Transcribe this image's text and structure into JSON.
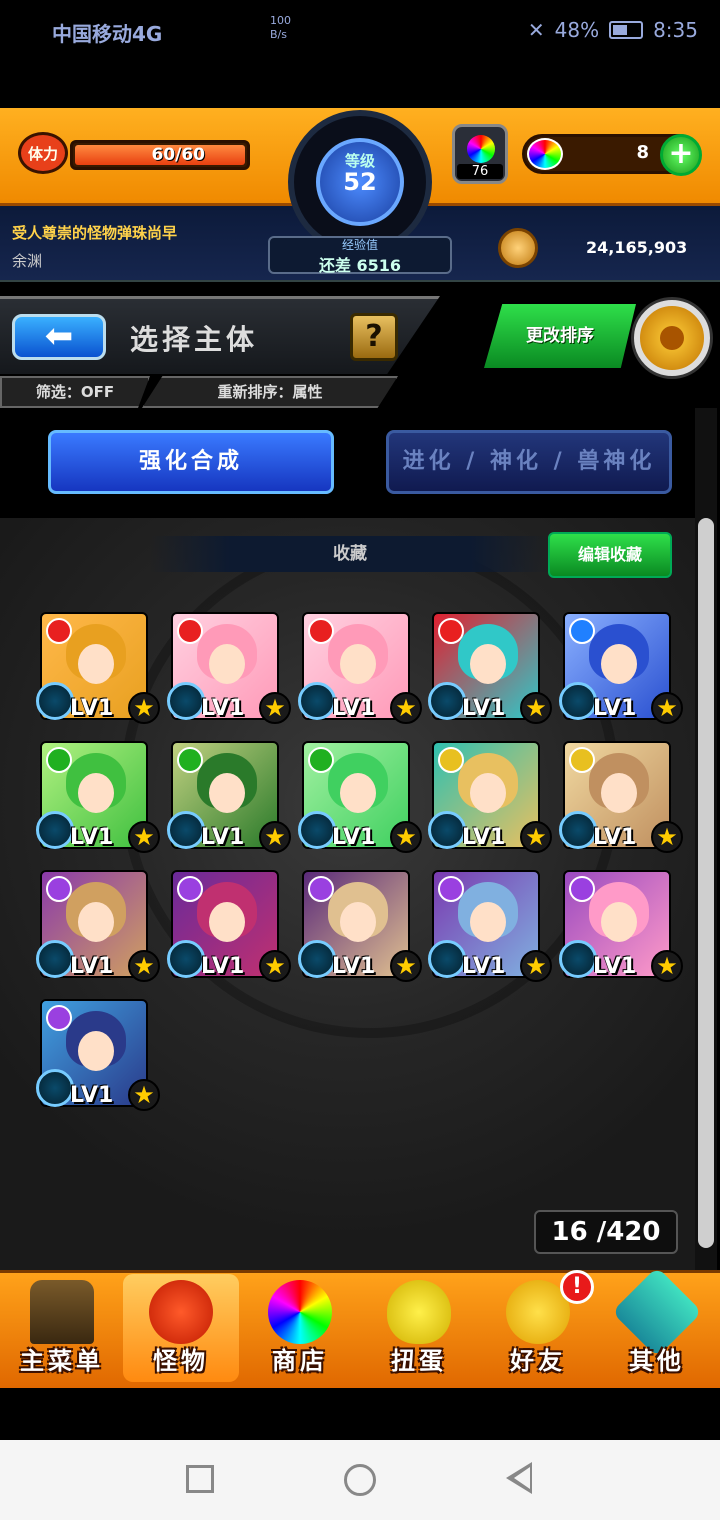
{
  "status_bar": {
    "carrier": "中国移动4G",
    "network_speed": "100\nB/s",
    "battery": "48%",
    "time": "8:35"
  },
  "hud": {
    "stamina_label": "体力",
    "stamina": "60/60",
    "rank_label": "等级",
    "rank": "52",
    "exp_label": "经验值",
    "exp_remaining": "还差 6516",
    "orb_item_count": "76",
    "orbs": "8",
    "player_title": "受人尊崇的怪物弹珠尚早",
    "player_name": "余渊",
    "gold": "24,165,903"
  },
  "header": {
    "title": "选择主体",
    "help": "?",
    "filter": "筛选：OFF",
    "sort": "重新排序：属性",
    "change_sort": "更改排序"
  },
  "tabs": [
    {
      "label": "强化合成",
      "active": true
    },
    {
      "label": "进化 / 神化 / 兽神化",
      "active": false
    }
  ],
  "favorites": {
    "title": "收藏",
    "edit": "编辑收藏"
  },
  "monsters": [
    {
      "level": "LV1",
      "element": "fire",
      "colors": [
        "#e8a020",
        "#ffb84a"
      ]
    },
    {
      "level": "LV1",
      "element": "fire",
      "colors": [
        "#ff9ab8",
        "#ffd0e0"
      ]
    },
    {
      "level": "LV1",
      "element": "fire",
      "colors": [
        "#ff9ab8",
        "#ffd0e0"
      ]
    },
    {
      "level": "LV1",
      "element": "fire",
      "colors": [
        "#30c8c8",
        "#e02030"
      ]
    },
    {
      "level": "LV1",
      "element": "water",
      "colors": [
        "#2a50d0",
        "#8ab0ff"
      ]
    },
    {
      "level": "LV1",
      "element": "wood",
      "colors": [
        "#40c040",
        "#b0f080"
      ]
    },
    {
      "level": "LV1",
      "element": "wood",
      "colors": [
        "#2a7a2a",
        "#c0d080"
      ]
    },
    {
      "level": "LV1",
      "element": "wood",
      "colors": [
        "#40d060",
        "#a0f0a0"
      ]
    },
    {
      "level": "LV1",
      "element": "light",
      "colors": [
        "#e8c060",
        "#30c0b0"
      ]
    },
    {
      "level": "LV1",
      "element": "light",
      "colors": [
        "#c09060",
        "#f0d8a0"
      ]
    },
    {
      "level": "LV1",
      "element": "dark",
      "colors": [
        "#d0a060",
        "#8a3aaa"
      ]
    },
    {
      "level": "LV1",
      "element": "dark",
      "colors": [
        "#c03070",
        "#6a2a9a"
      ]
    },
    {
      "level": "LV1",
      "element": "dark",
      "colors": [
        "#e0c090",
        "#5a2a7a"
      ]
    },
    {
      "level": "LV1",
      "element": "dark",
      "colors": [
        "#80b0e0",
        "#7a3ab0"
      ]
    },
    {
      "level": "LV1",
      "element": "dark",
      "colors": [
        "#ff9ac8",
        "#9a4ac0"
      ]
    },
    {
      "level": "LV1",
      "element": "dark",
      "colors": [
        "#2a3a8a",
        "#40a0e0"
      ]
    }
  ],
  "element_colors": {
    "fire": "#e82020",
    "water": "#2080ff",
    "wood": "#20b020",
    "light": "#e8c020",
    "dark": "#9a40e0"
  },
  "box_count": "16 /420",
  "bottom_nav": [
    {
      "label": "主菜单",
      "icon": "home-gate-icon"
    },
    {
      "label": "怪物",
      "icon": "monster-icon"
    },
    {
      "label": "商店",
      "icon": "rainbow-orb-icon"
    },
    {
      "label": "扭蛋",
      "icon": "gacha-egg-icon"
    },
    {
      "label": "好友",
      "icon": "friends-icon",
      "badge": "!"
    },
    {
      "label": "其他",
      "icon": "other-icon"
    }
  ]
}
